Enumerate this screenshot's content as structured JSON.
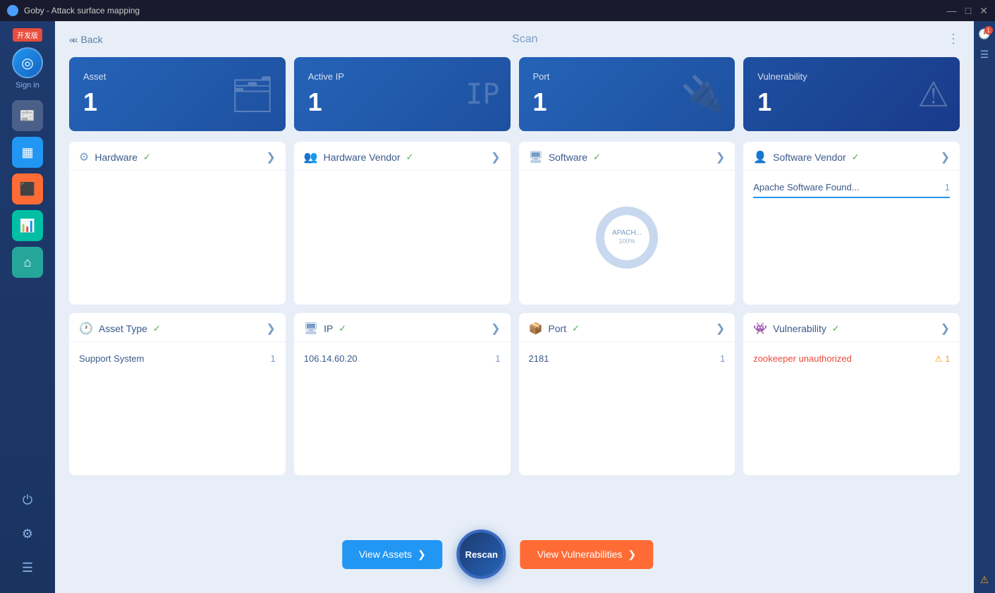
{
  "titlebar": {
    "title": "Goby - Attack surface mapping",
    "minimize": "—",
    "maximize": "□",
    "close": "✕"
  },
  "sidebar": {
    "dev_badge": "开发版",
    "sign_in": "Sign in",
    "items": [
      {
        "icon": "📰",
        "label": "news"
      },
      {
        "icon": "📋",
        "label": "scan-list"
      },
      {
        "icon": "🎯",
        "label": "targets"
      },
      {
        "icon": "📊",
        "label": "reports"
      },
      {
        "icon": "🏠",
        "label": "home"
      }
    ],
    "bottom": [
      {
        "icon": "⏻",
        "label": "power"
      },
      {
        "icon": "⚙",
        "label": "settings"
      },
      {
        "icon": "☰",
        "label": "menu"
      }
    ]
  },
  "header": {
    "back_label": "« Back",
    "title": "Scan",
    "more_icon": "⋮"
  },
  "stats": [
    {
      "label": "Asset",
      "value": "1",
      "icon": "🗂"
    },
    {
      "label": "Active IP",
      "value": "1",
      "icon": "🌐"
    },
    {
      "label": "Port",
      "value": "1",
      "icon": "🔌"
    },
    {
      "label": "Vulnerability",
      "value": "1",
      "icon": "⚠"
    }
  ],
  "panels_top": [
    {
      "id": "hardware",
      "icon": "⚙",
      "title": "Hardware",
      "items": []
    },
    {
      "id": "hardware-vendor",
      "icon": "👥",
      "title": "Hardware Vendor",
      "items": []
    },
    {
      "id": "software",
      "icon": "🖥",
      "title": "Software",
      "donut": {
        "label": "APACH...",
        "percent": "100%",
        "value": 100
      }
    },
    {
      "id": "software-vendor",
      "icon": "👤",
      "title": "Software Vendor",
      "items": [
        {
          "name": "Apache Software Found...",
          "value": "1"
        }
      ]
    }
  ],
  "panels_bottom": [
    {
      "id": "asset-type",
      "icon": "🕐",
      "title": "Asset Type",
      "items": [
        {
          "name": "Support System",
          "value": "1"
        }
      ]
    },
    {
      "id": "ip",
      "icon": "🖥",
      "title": "IP",
      "items": [
        {
          "name": "106.14.60.20",
          "value": "1"
        }
      ]
    },
    {
      "id": "port",
      "icon": "📦",
      "title": "Port",
      "items": [
        {
          "name": "2181",
          "value": "1"
        }
      ]
    },
    {
      "id": "vulnerability",
      "icon": "👾",
      "title": "Vulnerability",
      "items": [
        {
          "name": "zookeeper unauthorized",
          "severity": "warning",
          "value": "1"
        }
      ]
    }
  ],
  "actions": {
    "rescan_label": "Rescan",
    "view_assets_label": "View Assets",
    "view_vulns_label": "View Vulnerabilities"
  },
  "colors": {
    "primary_blue": "#2196F3",
    "orange": "#FF6B35",
    "red": "#e74c3c",
    "green": "#4CAF50",
    "sidebar_bg": "#1e3a6e"
  }
}
